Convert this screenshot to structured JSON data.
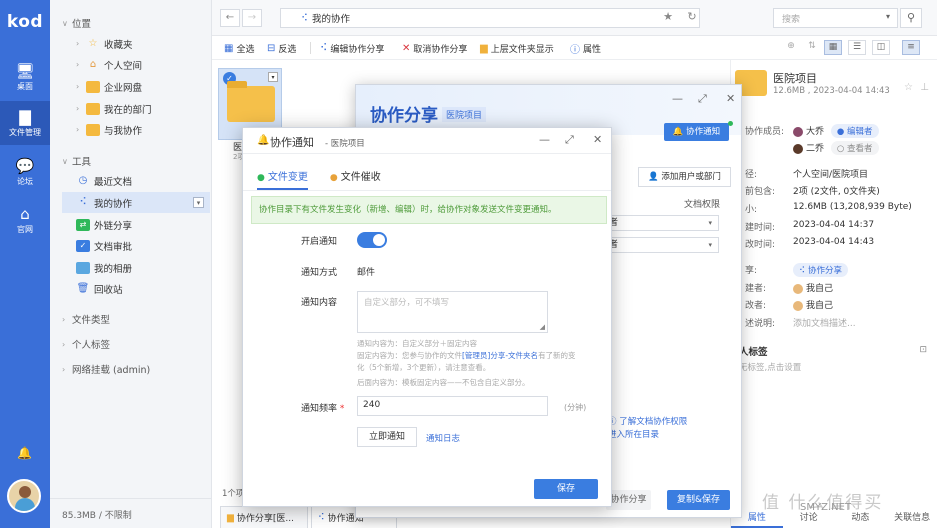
{
  "app": {
    "logo": "kod",
    "nav": [
      {
        "label": "桌面",
        "icon": "monitor-icon"
      },
      {
        "label": "文件管理",
        "icon": "folder-icon"
      },
      {
        "label": "论坛",
        "icon": "chat-icon"
      },
      {
        "label": "官网",
        "icon": "home-icon"
      }
    ]
  },
  "tree": {
    "location_title": "位置",
    "location_items": [
      "收藏夹",
      "个人空间",
      "企业网盘",
      "我在的部门",
      "与我协作"
    ],
    "tools_title": "工具",
    "tools_items": [
      "最近文档",
      "我的协作",
      "外链分享",
      "文档审批",
      "我的相册",
      "回收站"
    ],
    "filetype_title": "文件类型",
    "tags_title": "个人标签",
    "network_title": "网络挂载 (admin)",
    "storage": "85.3MB / 不限制"
  },
  "address": {
    "path": "我的协作",
    "search_placeholder": "搜索"
  },
  "toolbar": {
    "select_all": "全选",
    "invert": "反选",
    "edit_share": "编辑协作分享",
    "cancel_share": "取消协作分享",
    "parent_folder": "上层文件夹显示",
    "properties": "属性"
  },
  "files": {
    "name": "医",
    "size": "2项",
    "count": "1个项"
  },
  "taskbar": [
    {
      "label": "协作分享[医..."
    },
    {
      "label": "协作通知"
    }
  ],
  "info": {
    "title": "医院项目",
    "meta": "12.6MB , 2023-04-04 14:43",
    "rows": [
      {
        "label": "协作成员:",
        "value": "大乔",
        "tag": "编辑者"
      },
      {
        "label": "",
        "value": "二乔",
        "tag": "查看者"
      },
      {
        "label": "径:",
        "value": "个人空间/医院项目"
      },
      {
        "label": "前包含:",
        "value": "2项 (2文件, 0文件夹)"
      },
      {
        "label": "小:",
        "value": "12.6MB (13,208,939 Byte)"
      },
      {
        "label": "建时间:",
        "value": "2023-04-04 14:37"
      },
      {
        "label": "改时间:",
        "value": "2023-04-04 14:43"
      },
      {
        "label": "享:",
        "value": "协作分享"
      },
      {
        "label": "建者:",
        "value": "我自己"
      },
      {
        "label": "改者:",
        "value": "我自己"
      },
      {
        "label": "述说明:",
        "value": "添加文档描述..."
      }
    ],
    "tags_title": "人标签",
    "tags_placeholder": "无标签,点击设置",
    "tabs": [
      "属性",
      "讨论",
      "动态",
      "关联信息"
    ]
  },
  "share_dialog": {
    "title": "协作分享",
    "subtitle": "医院项目",
    "notify_btn": "协作通知",
    "add_user": "添加用户或部门",
    "perm_header": "文档权限",
    "perm1": "者",
    "perm2": "者",
    "link1": "了解文档协作权限",
    "link2": "进入所在目录",
    "cancel_btn": "协作分享",
    "copy_save_btn": "复制&保存"
  },
  "notify_dialog": {
    "title": "协作通知",
    "subtitle": "- 医院项目",
    "tab_change": "文件变更",
    "tab_remind": "文件催收",
    "tip": "协作目录下有文件发生变化（新增、编辑）时，给协作对象发送文件变更通知。",
    "enable_label": "开启通知",
    "method_label": "通知方式",
    "method_value": "邮件",
    "content_label": "通知内容",
    "content_placeholder": "自定义部分，可不填写",
    "hint1": "通知内容为：自定义部分＋固定内容",
    "hint2a": "固定内容为：您参与协作的文件",
    "hint2b": "[管理员]分享-文件夹名",
    "hint2c": "有了新的变",
    "hint3": "化（5个新增，3个更新），请注意查看。",
    "hint4": "后面内容为：模板固定内容——不包含自定义部分。",
    "freq_label": "通知频率",
    "freq_required": "*",
    "freq_value": "240",
    "freq_unit": "(分钟)",
    "notify_now": "立即通知",
    "notify_log": "通知日志",
    "save": "保存"
  },
  "watermark": {
    "brand": "值 什么值得买",
    "site": "SMYZ.NET"
  }
}
